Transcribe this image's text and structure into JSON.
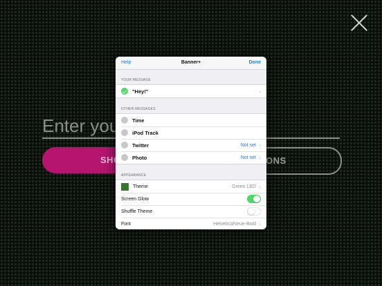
{
  "background": {
    "message_placeholder": "Enter your",
    "show_button_label": "SHO",
    "options_button_label": "ONS"
  },
  "modal": {
    "help_label": "Help",
    "title": "Banner+",
    "done_label": "Done",
    "your_message": {
      "header": "YOUR MESSAGE",
      "selected_message": "\"Hey!\""
    },
    "other_messages": {
      "header": "OTHER MESSAGES",
      "items": [
        {
          "label": "Time",
          "value": ""
        },
        {
          "label": "iPod Track",
          "value": ""
        },
        {
          "label": "Twitter",
          "value": "Not set"
        },
        {
          "label": "Photo",
          "value": "Not set"
        }
      ]
    },
    "appearance": {
      "header": "APPEARANCE",
      "theme_label": "Theme",
      "theme_value": "Green LED",
      "screen_glow_label": "Screen Glow",
      "screen_glow_on": true,
      "shuffle_theme_label": "Shuffle Theme",
      "shuffle_theme_on": false,
      "font_label": "Font",
      "font_value": "HelveticaNeue-Bold"
    }
  },
  "colors": {
    "accent": "#147efb",
    "toggle_on": "#4cd964",
    "show_button": "#b5156f"
  }
}
